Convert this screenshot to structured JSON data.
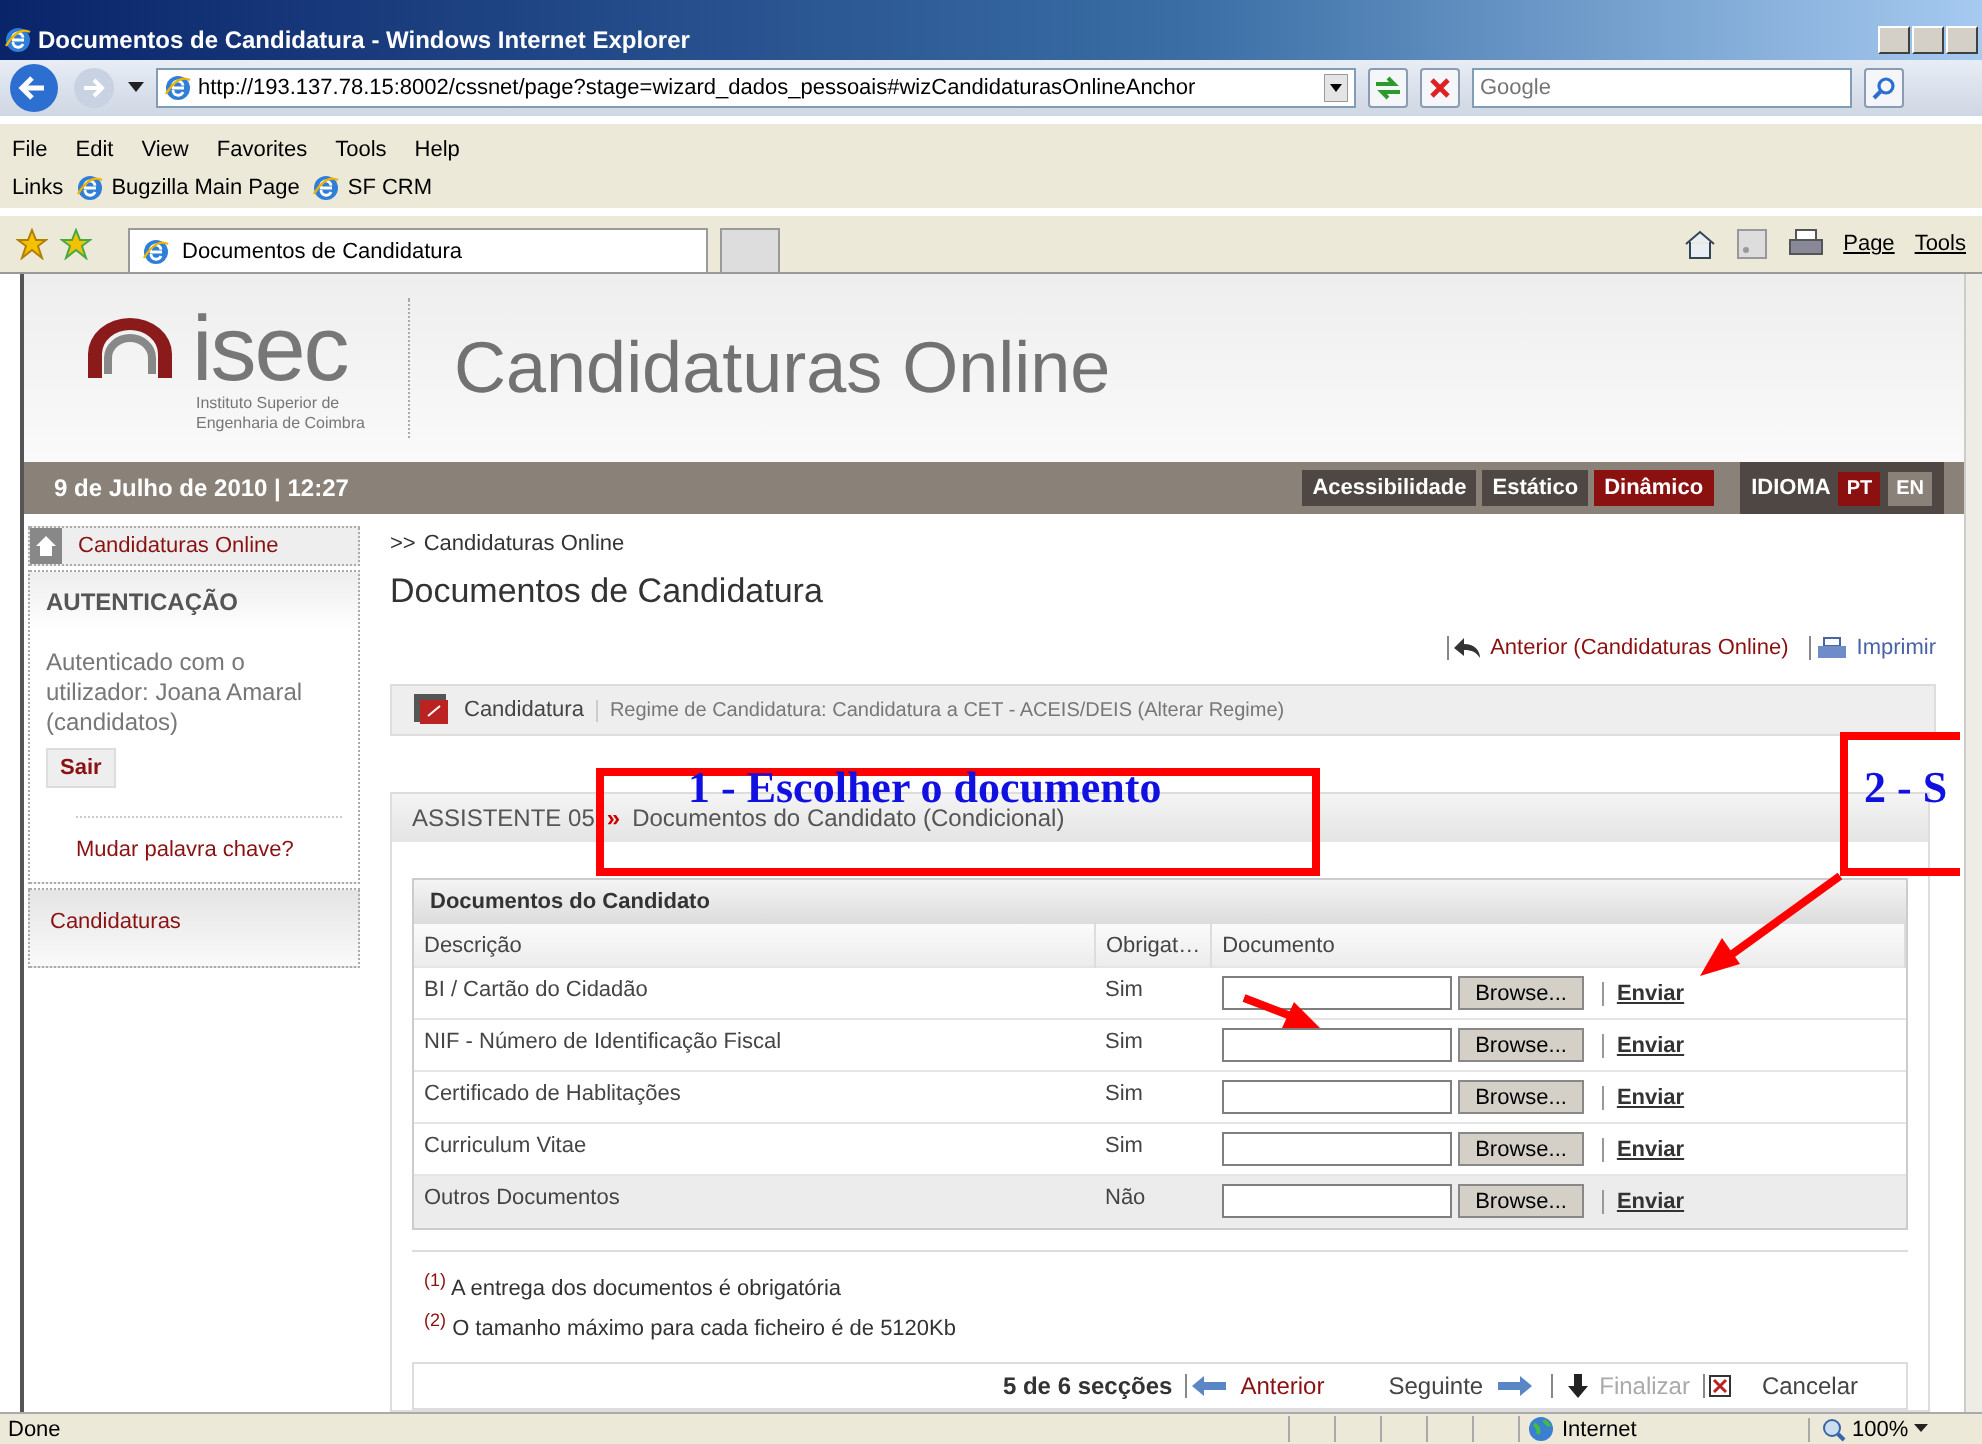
{
  "window": {
    "title": "Documentos de Candidatura - Windows Internet Explorer"
  },
  "address_bar": {
    "url": "http://193.137.78.15:8002/cssnet/page?stage=wizard_dados_pessoais#wizCandidaturasOnlineAnchor",
    "search_placeholder": "Google"
  },
  "menu": [
    "File",
    "Edit",
    "View",
    "Favorites",
    "Tools",
    "Help"
  ],
  "links_bar": {
    "label": "Links",
    "items": [
      "Bugzilla Main Page",
      "SF CRM"
    ]
  },
  "tabs": [
    {
      "label": "Documentos de Candidatura",
      "selected": true
    }
  ],
  "command_bar": [
    "Page",
    "Tools"
  ],
  "header": {
    "logo_word": "isec",
    "institute": "Instituto Superior de Engenharia de Coimbra",
    "title": "Candidaturas Online"
  },
  "top_bar": {
    "date": "9 de Julho de 2010 | 12:27",
    "view_buttons": [
      {
        "label": "Acessibilidade",
        "selected": false
      },
      {
        "label": "Estático",
        "selected": false
      },
      {
        "label": "Dinâmico",
        "selected": true
      }
    ],
    "language_label": "IDIOMA",
    "languages": [
      {
        "label": "PT",
        "selected": true
      },
      {
        "label": "EN",
        "selected": false
      }
    ]
  },
  "sidebar": {
    "home_link": "Candidaturas Online",
    "auth_title": "AUTENTICAÇÃO",
    "auth_text": "Autenticado com o utilizador: Joana Amaral (candidatos)",
    "logout": "Sair",
    "change_password": "Mudar palavra chave?",
    "section": "Candidaturas"
  },
  "main": {
    "breadcrumb_marker": ">>",
    "breadcrumb": "Candidaturas Online",
    "title": "Documentos de Candidatura",
    "back_link": "Anterior (Candidaturas Online)",
    "print_link": "Imprimir",
    "context_label": "Candidatura",
    "regime": "Regime de Candidatura: Candidatura a CET - ACEIS/DEIS (Alterar Regime)",
    "wizard_step": "ASSISTENTE 05",
    "wizard_separator": "»",
    "wizard_title": "Documentos do Candidato (Condicional)"
  },
  "table": {
    "title": "Documentos do Candidato",
    "columns": [
      "Descrição",
      "Obrigat…",
      "Documento"
    ],
    "rows": [
      {
        "description": "BI / Cartão do Cidadão",
        "required": "Sim",
        "browse": "Browse...",
        "action": "Enviar",
        "selected": false
      },
      {
        "description": "NIF - Número de Identificação Fiscal",
        "required": "Sim",
        "browse": "Browse...",
        "action": "Enviar",
        "selected": false
      },
      {
        "description": "Certificado de Hablitações",
        "required": "Sim",
        "browse": "Browse...",
        "action": "Enviar",
        "selected": false
      },
      {
        "description": "Curriculum Vitae",
        "required": "Sim",
        "browse": "Browse...",
        "action": "Enviar",
        "selected": false
      },
      {
        "description": "Outros Documentos",
        "required": "Não",
        "browse": "Browse...",
        "action": "Enviar",
        "selected": true
      }
    ]
  },
  "footnotes": [
    {
      "mark": "(1)",
      "text": "A entrega dos documentos é obrigatória"
    },
    {
      "mark": "(2)",
      "text": "O tamanho máximo para cada ficheiro é de 5120Kb"
    }
  ],
  "wizard_footer": {
    "progress": "5 de 6 secções",
    "previous": "Anterior",
    "next": "Seguinte",
    "finish": "Finalizar",
    "finish_disabled": true,
    "cancel": "Cancelar"
  },
  "annotations": [
    {
      "text": "1 - Escolher o documento"
    },
    {
      "text": "2 - S"
    }
  ],
  "status_bar": {
    "status": "Done",
    "zone": "Internet",
    "zoom": "100%"
  }
}
